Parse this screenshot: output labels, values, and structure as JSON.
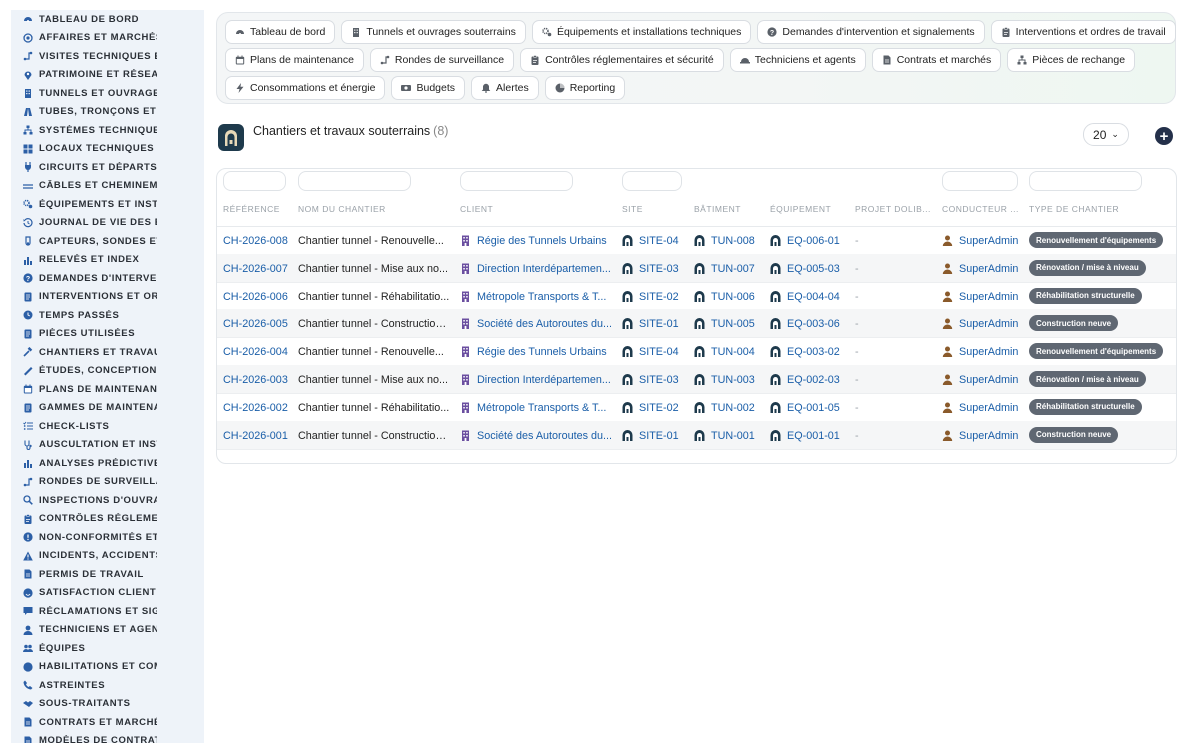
{
  "sidebar": {
    "items": [
      {
        "label": "TABLEAU DE BORD",
        "icon": "dashboard-icon"
      },
      {
        "label": "AFFAIRES ET MARCHÉS",
        "icon": "target-icon"
      },
      {
        "label": "VISITES TECHNIQUES ET",
        "icon": "route-icon"
      },
      {
        "label": "PATRIMOINE ET RÉSEAUX",
        "icon": "map-pin-icon"
      },
      {
        "label": "TUNNELS ET OUVRAGES",
        "icon": "building-icon"
      },
      {
        "label": "TUBES, TRONÇONS ET ZO",
        "icon": "road-icon"
      },
      {
        "label": "SYSTÈMES TECHNIQUES",
        "icon": "sitemap-icon"
      },
      {
        "label": "LOCAUX TECHNIQUES ET",
        "icon": "grid-icon"
      },
      {
        "label": "CIRCUITS ET DÉPARTS É",
        "icon": "plug-icon"
      },
      {
        "label": "CÂBLES ET CHEMINEMEN",
        "icon": "cable-icon"
      },
      {
        "label": "ÉQUIPEMENTS ET INSTAL",
        "icon": "gears-icon"
      },
      {
        "label": "JOURNAL DE VIE DES ÉQ",
        "icon": "history-icon"
      },
      {
        "label": "CAPTEURS, SONDES ET C",
        "icon": "sensor-icon"
      },
      {
        "label": "RELEVÉS ET INDEX",
        "icon": "chart-icon"
      },
      {
        "label": "DEMANDES D'INTERVENT",
        "icon": "question-icon"
      },
      {
        "label": "INTERVENTIONS ET ORDR",
        "icon": "list-icon"
      },
      {
        "label": "TEMPS PASSÉS",
        "icon": "clock-icon"
      },
      {
        "label": "PIÈCES UTILISÉES",
        "icon": "list-icon"
      },
      {
        "label": "CHANTIERS ET TRAVAUX",
        "icon": "hammer-icon"
      },
      {
        "label": "ÉTUDES, CONCEPTION ET",
        "icon": "ruler-icon"
      },
      {
        "label": "PLANS DE MAINTENANCE",
        "icon": "calendar-icon"
      },
      {
        "label": "GAMMES DE MAINTENAN",
        "icon": "list-icon"
      },
      {
        "label": "CHECK-LISTS",
        "icon": "checklist-icon"
      },
      {
        "label": "AUSCULTATION ET INSTR",
        "icon": "stethoscope-icon"
      },
      {
        "label": "ANALYSES PRÉDICTIVES",
        "icon": "chart-icon"
      },
      {
        "label": "RONDES DE SURVEILLAN",
        "icon": "route-icon"
      },
      {
        "label": "INSPECTIONS D'OUVRAG",
        "icon": "search-icon"
      },
      {
        "label": "CONTRÔLES RÉGLEMENT",
        "icon": "clipboard-icon"
      },
      {
        "label": "NON-CONFORMITÉS ET A",
        "icon": "alert-circle-icon"
      },
      {
        "label": "INCIDENTS, ACCIDENTS E",
        "icon": "warning-icon"
      },
      {
        "label": "PERMIS DE TRAVAIL",
        "icon": "document-icon"
      },
      {
        "label": "SATISFACTION CLIENT",
        "icon": "smile-icon"
      },
      {
        "label": "RÉCLAMATIONS ET SIGNA",
        "icon": "comment-icon"
      },
      {
        "label": "TECHNICIENS ET AGENTS",
        "icon": "user-icon"
      },
      {
        "label": "ÉQUIPES",
        "icon": "users-icon"
      },
      {
        "label": "HABILITATIONS ET COMP",
        "icon": "badge-icon"
      },
      {
        "label": "ASTREINTES",
        "icon": "phone-icon"
      },
      {
        "label": "SOUS-TRAITANTS",
        "icon": "handshake-icon"
      },
      {
        "label": "CONTRATS ET MARCHÉS",
        "icon": "document-icon"
      },
      {
        "label": "MODÈLES DE CONTRATS",
        "icon": "document-icon"
      }
    ]
  },
  "topmenu": {
    "rows": [
      [
        {
          "label": "Tableau de bord",
          "icon": "dashboard-icon"
        },
        {
          "label": "Tunnels et ouvrages souterrains",
          "icon": "building-icon"
        },
        {
          "label": "Équipements et installations techniques",
          "icon": "gears-icon"
        },
        {
          "label": "Demandes d'intervention et signalements",
          "icon": "question-icon"
        },
        {
          "label": "Interventions et ordres de travail",
          "icon": "clipboard-icon"
        }
      ],
      [
        {
          "label": "Plans de maintenance",
          "icon": "calendar-icon"
        },
        {
          "label": "Rondes de surveillance",
          "icon": "route-icon"
        },
        {
          "label": "Contrôles réglementaires et sécurité",
          "icon": "clipboard-icon"
        },
        {
          "label": "Techniciens et agents",
          "icon": "helmet-icon"
        },
        {
          "label": "Contrats et marchés",
          "icon": "document-icon"
        },
        {
          "label": "Pièces de rechange",
          "icon": "sitemap-icon"
        }
      ],
      [
        {
          "label": "Consommations et énergie",
          "icon": "bolt-icon"
        },
        {
          "label": "Budgets",
          "icon": "money-icon"
        },
        {
          "label": "Alertes",
          "icon": "bell-icon"
        },
        {
          "label": "Reporting",
          "icon": "pie-icon"
        }
      ]
    ]
  },
  "page": {
    "title": "Chantiers et travaux souterrains",
    "count": "(8)",
    "per_page": "20",
    "add_label": "+"
  },
  "table": {
    "columns": [
      "RÉFÉRENCE",
      "NOM DU CHANTIER",
      "CLIENT",
      "SITE",
      "BÂTIMENT",
      "ÉQUIPEMENT",
      "PROJET DOLIB...",
      "CONDUCTEUR ...",
      "TYPE DE CHANTIER"
    ],
    "rows": [
      {
        "ref": "CH-2026-008",
        "name": "Chantier tunnel - Renouvelle...",
        "client": "Régie des Tunnels Urbains",
        "site": "SITE-04",
        "batiment": "TUN-008",
        "equipement": "EQ-006-01",
        "projet": "-",
        "conducteur": "SuperAdmin",
        "type": "Renouvellement d'équipements"
      },
      {
        "ref": "CH-2026-007",
        "name": "Chantier tunnel - Mise aux no...",
        "client": "Direction Interdépartemen...",
        "site": "SITE-03",
        "batiment": "TUN-007",
        "equipement": "EQ-005-03",
        "projet": "-",
        "conducteur": "SuperAdmin",
        "type": "Rénovation / mise à niveau"
      },
      {
        "ref": "CH-2026-006",
        "name": "Chantier tunnel - Réhabilitatio...",
        "client": "Métropole Transports & T...",
        "site": "SITE-02",
        "batiment": "TUN-006",
        "equipement": "EQ-004-04",
        "projet": "-",
        "conducteur": "SuperAdmin",
        "type": "Réhabilitation structurelle"
      },
      {
        "ref": "CH-2026-005",
        "name": "Chantier tunnel - Construction...",
        "client": "Société des Autoroutes du...",
        "site": "SITE-01",
        "batiment": "TUN-005",
        "equipement": "EQ-003-06",
        "projet": "-",
        "conducteur": "SuperAdmin",
        "type": "Construction neuve"
      },
      {
        "ref": "CH-2026-004",
        "name": "Chantier tunnel - Renouvelle...",
        "client": "Régie des Tunnels Urbains",
        "site": "SITE-04",
        "batiment": "TUN-004",
        "equipement": "EQ-003-02",
        "projet": "-",
        "conducteur": "SuperAdmin",
        "type": "Renouvellement d'équipements"
      },
      {
        "ref": "CH-2026-003",
        "name": "Chantier tunnel - Mise aux no...",
        "client": "Direction Interdépartemen...",
        "site": "SITE-03",
        "batiment": "TUN-003",
        "equipement": "EQ-002-03",
        "projet": "-",
        "conducteur": "SuperAdmin",
        "type": "Rénovation / mise à niveau"
      },
      {
        "ref": "CH-2026-002",
        "name": "Chantier tunnel - Réhabilitatio...",
        "client": "Métropole Transports & T...",
        "site": "SITE-02",
        "batiment": "TUN-002",
        "equipement": "EQ-001-05",
        "projet": "-",
        "conducteur": "SuperAdmin",
        "type": "Réhabilitation structurelle"
      },
      {
        "ref": "CH-2026-001",
        "name": "Chantier tunnel - Construction...",
        "client": "Société des Autoroutes du...",
        "site": "SITE-01",
        "batiment": "TUN-001",
        "equipement": "EQ-001-01",
        "projet": "-",
        "conducteur": "SuperAdmin",
        "type": "Construction neuve"
      }
    ]
  },
  "colors": {
    "link": "#1a5ea8",
    "icon_blue": "#2c5fa6",
    "badge": "#5f6772",
    "sidebar_bg": "#eef3f9",
    "add_button": "#24304a"
  }
}
